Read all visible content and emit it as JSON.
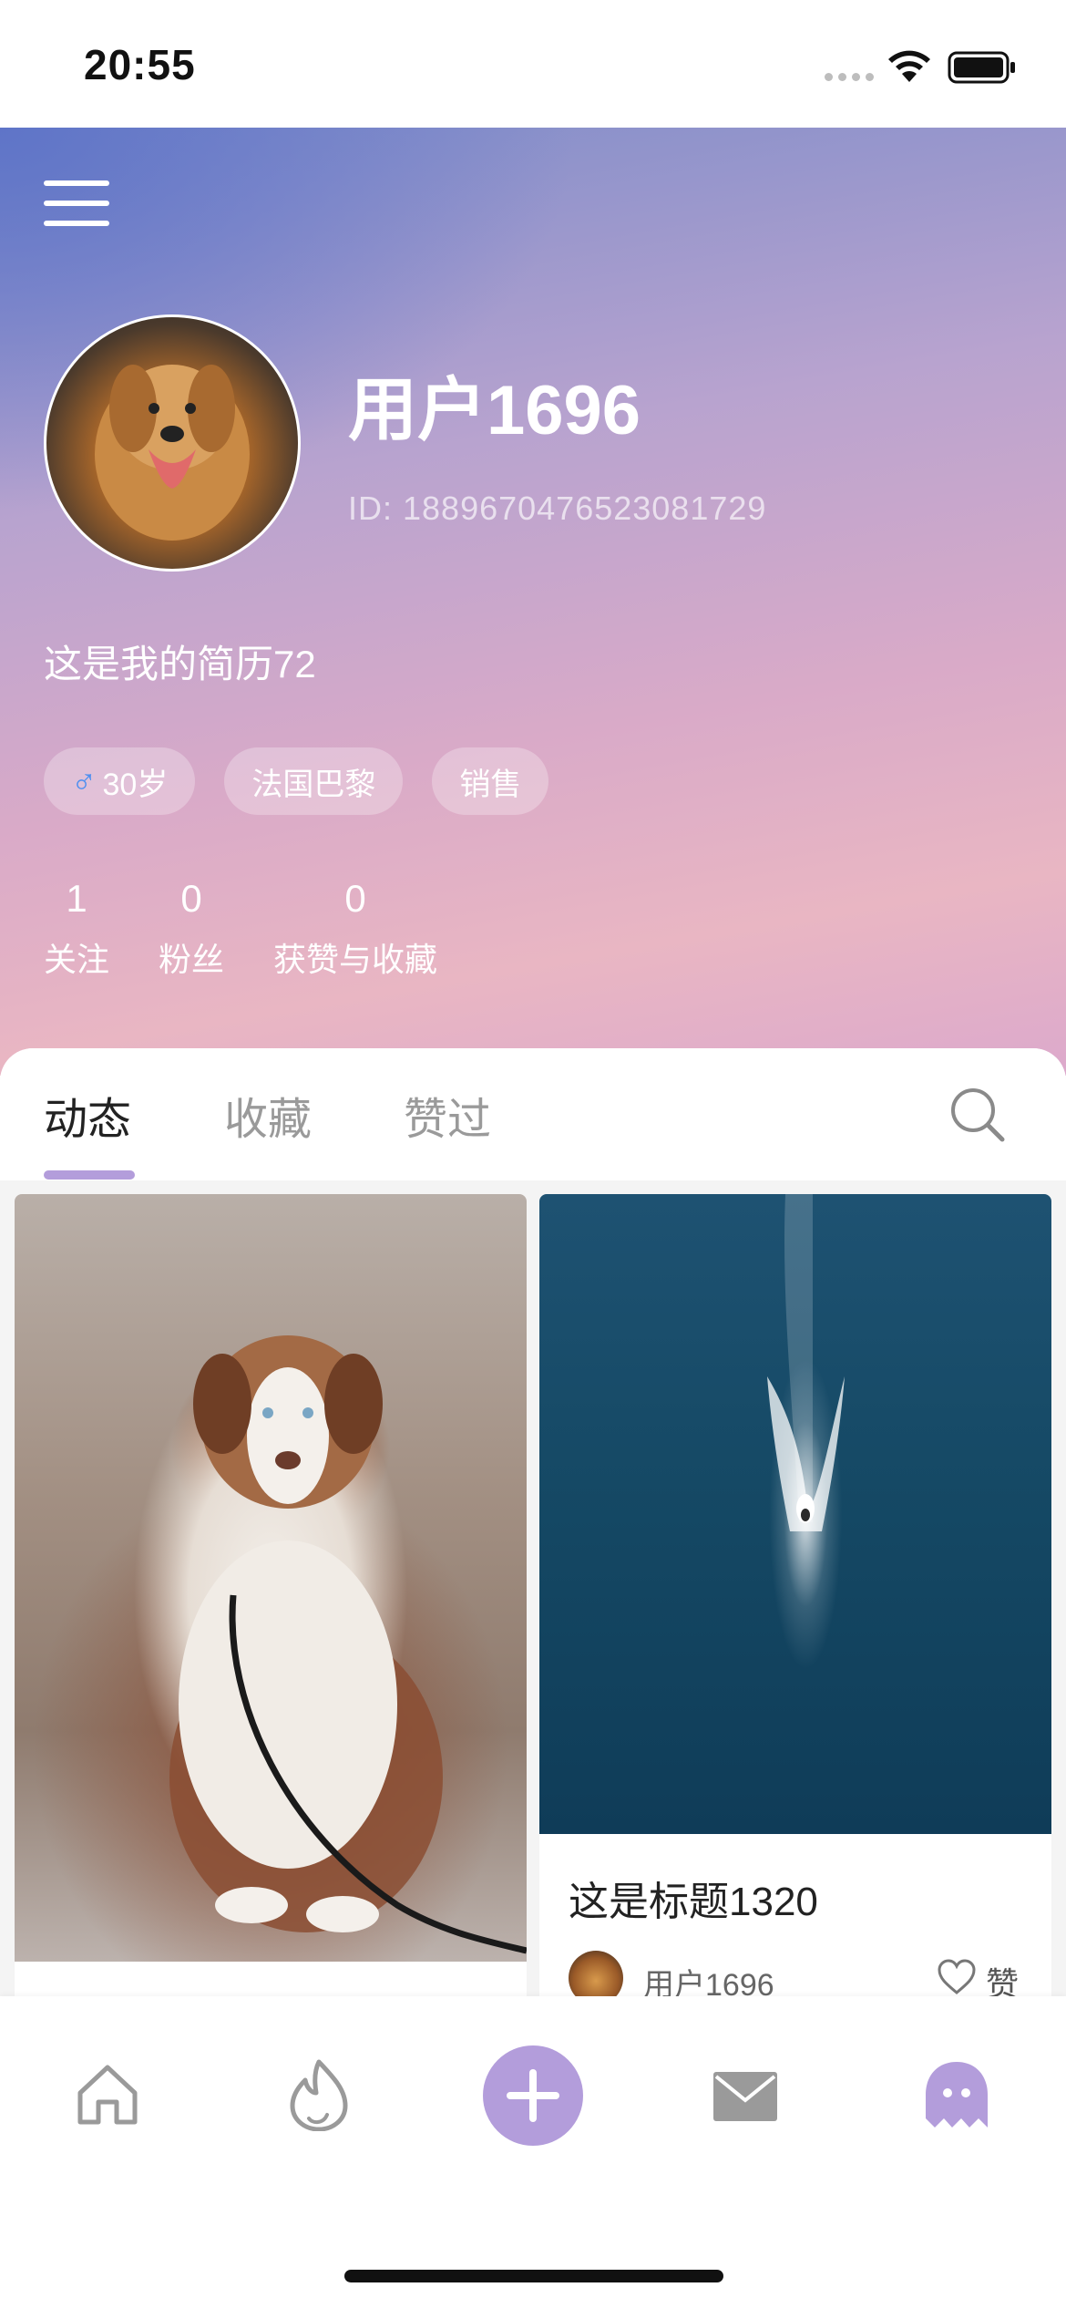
{
  "status_bar": {
    "time": "20:55"
  },
  "header": {
    "username": "用户1696",
    "user_id": "ID: 1889670476523081729",
    "bio": "这是我的简历72",
    "tags": [
      {
        "icon": "male-icon",
        "symbol": "♂",
        "label": "30岁"
      },
      {
        "label": "法国巴黎"
      },
      {
        "label": "销售"
      }
    ],
    "stats": [
      {
        "value": "1",
        "label": "关注"
      },
      {
        "value": "0",
        "label": "粉丝"
      },
      {
        "value": "0",
        "label": "获赞与收藏"
      }
    ]
  },
  "tabs": [
    {
      "label": "动态",
      "active": true
    },
    {
      "label": "收藏",
      "active": false
    },
    {
      "label": "赞过",
      "active": false
    }
  ],
  "posts": [
    {
      "image": "dog-photo"
    },
    {
      "image": "sea-photo",
      "title": "这是标题1320",
      "author": "用户1696",
      "like_label": "赞"
    }
  ],
  "tabbar": {
    "items": [
      "home-icon",
      "fire-icon",
      "add-icon",
      "mail-icon",
      "ghost-icon"
    ],
    "active_color": "#b39ddb"
  },
  "colors": {
    "accent": "#b39ddb",
    "male": "#4d8ff0"
  }
}
